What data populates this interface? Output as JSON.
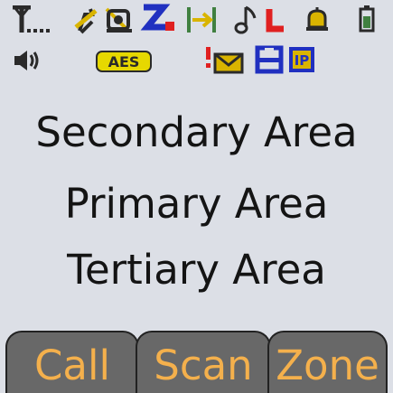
{
  "status_bar": {
    "row1_icons": [
      "antenna-signal-icon",
      "no-talkaround-icon",
      "monitor-icon",
      "scan-icon",
      "direct-mode-icon",
      "music-note-icon",
      "low-power-icon",
      "alarm-bell-icon",
      "battery-icon"
    ],
    "row2_icons": [
      "speaker-icon",
      "aes-encryption-icon",
      "new-message-icon",
      "storage-icon",
      "ip-icon"
    ],
    "aes_badge_text": "AES",
    "ip_badge_text": "IP",
    "colors": {
      "aes_badge": "#e6d800",
      "alert_red": "#e02020",
      "storage_blue": "#2030c0",
      "direct_green": "#408040"
    }
  },
  "main_area": {
    "lines": [
      "Secondary Area",
      "Primary Area",
      "Tertiary Area"
    ]
  },
  "softkeys": [
    {
      "label": "Call"
    },
    {
      "label": "Scan"
    },
    {
      "label": "Zone"
    }
  ],
  "colors": {
    "background": "#dcdfe6",
    "softkey_background": "#686868",
    "softkey_text": "#f4b04c",
    "main_text": "#141414"
  }
}
